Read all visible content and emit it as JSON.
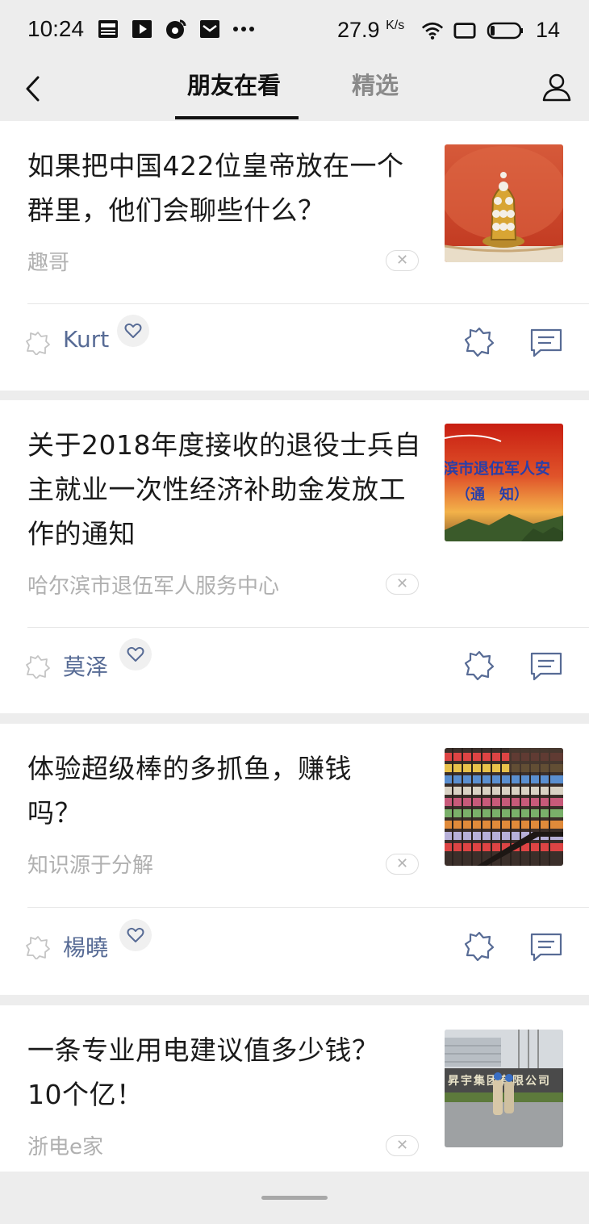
{
  "status_bar": {
    "time": "10:24",
    "speed_value": "27.9",
    "speed_unit": "K/s",
    "battery": "14"
  },
  "header": {
    "tabs": [
      {
        "label": "朋友在看",
        "active": true
      },
      {
        "label": "精选",
        "active": false
      }
    ]
  },
  "articles": [
    {
      "title": "如果把中国422位皇帝放在一个群里，他们会聊些什么？",
      "source": "趣哥",
      "friend": "Kurt",
      "thumb": "imperial-hat"
    },
    {
      "title": "关于2018年度接收的退役士兵自主就业一次性经济补助金发放工作的通知",
      "source": "哈尔滨市退伍军人服务中心",
      "friend": "莫泽",
      "thumb": "notice-banner",
      "thumb_text_top": "滨市退伍军人安",
      "thumb_text_mid": "（通　知）"
    },
    {
      "title": "体验超级棒的多抓鱼，赚钱吗？",
      "source": "知识源于分解",
      "friend": "楊曉",
      "thumb": "bookstore"
    },
    {
      "title": "一条专业用电建议值多少钱？10个亿！",
      "source": "浙电e家",
      "thumb": "factory-gate",
      "thumb_text": "昇宇集团有限公司"
    }
  ],
  "colors": {
    "background": "#ededed",
    "card": "#ffffff",
    "friend_name": "#576b95",
    "source": "#b0b0b0"
  }
}
